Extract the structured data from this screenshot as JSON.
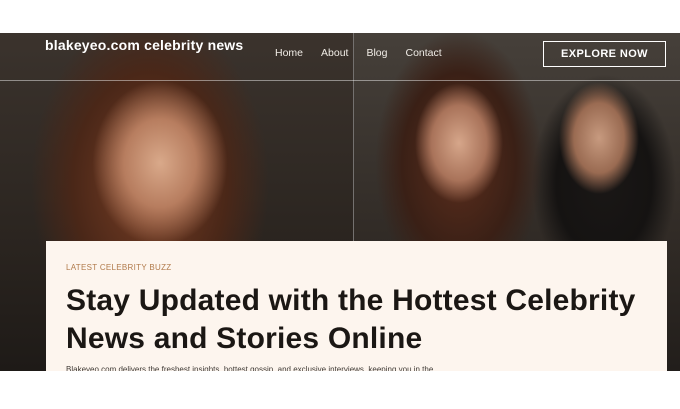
{
  "header": {
    "brand": "blakeyeo.com celebrity news",
    "nav": [
      "Home",
      "About",
      "Blog",
      "Contact"
    ],
    "cta_label": "EXPLORE NOW"
  },
  "hero": {
    "kicker": "LATEST CELEBRITY BUZZ",
    "headline": "Stay Updated with the Hottest Celebrity News and Stories Online",
    "lead": "Blakeyeo.com delivers the freshest insights, hottest gossip, and exclusive interviews, keeping you in the"
  },
  "colors": {
    "card_bg": "#fdf5ee",
    "kicker": "#b17a4b",
    "headline": "#1b1714"
  }
}
